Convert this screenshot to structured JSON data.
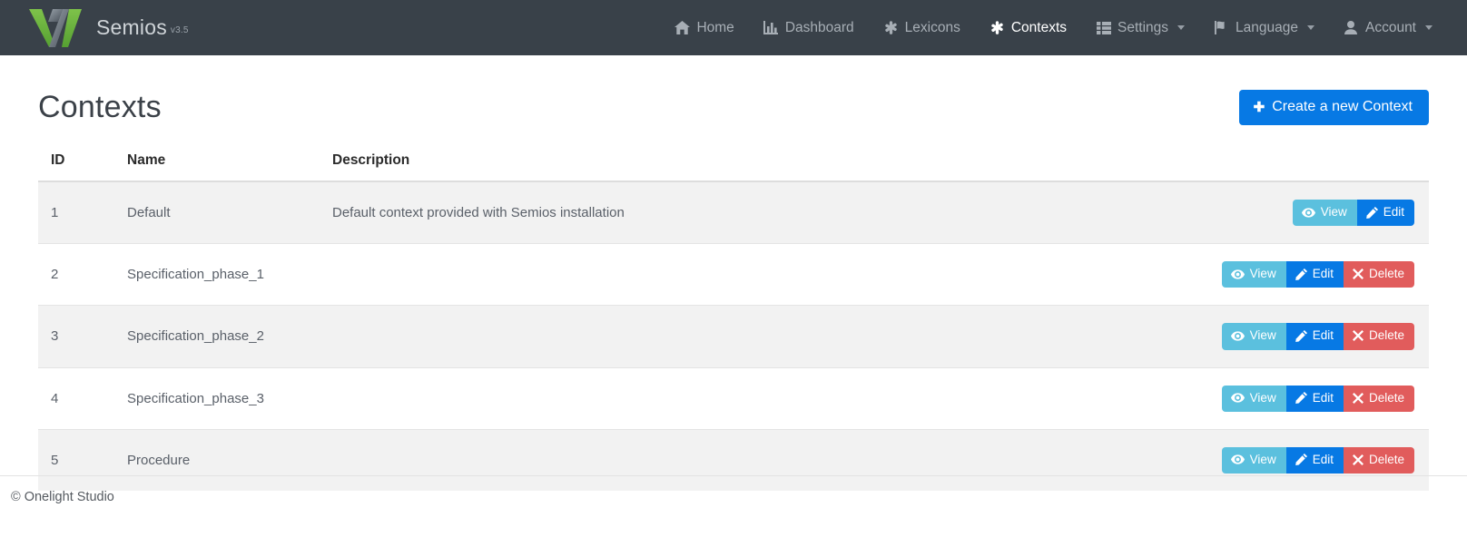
{
  "navbar": {
    "brand": {
      "name": "Semios",
      "version": "v3.5",
      "logo_icon": "semios-logo-icon"
    },
    "background_color": "#394149",
    "items": [
      {
        "label": "Home",
        "icon": "home-icon",
        "active": false,
        "caret": false
      },
      {
        "label": "Dashboard",
        "icon": "bar-chart-icon",
        "active": false,
        "caret": false
      },
      {
        "label": "Lexicons",
        "icon": "asterisk-icon",
        "active": false,
        "caret": false
      },
      {
        "label": "Contexts",
        "icon": "asterisk-icon",
        "active": true,
        "caret": false
      },
      {
        "label": "Settings",
        "icon": "th-list-icon",
        "active": false,
        "caret": true
      },
      {
        "label": "Language",
        "icon": "flag-icon",
        "active": false,
        "caret": true
      },
      {
        "label": "Account",
        "icon": "user-icon",
        "active": false,
        "caret": true
      }
    ]
  },
  "page": {
    "title": "Contexts",
    "create_button": {
      "label": "Create a new Context",
      "icon": "plus-icon",
      "color": "#0779e4"
    }
  },
  "table": {
    "columns": [
      "ID",
      "Name",
      "Description",
      ""
    ],
    "rows": [
      {
        "id": "1",
        "name": "Default",
        "description": "Default context provided with Semios installation",
        "actions": [
          {
            "label": "View",
            "icon": "eye-icon",
            "kind": "view"
          },
          {
            "label": "Edit",
            "icon": "pencil-icon",
            "kind": "edit"
          }
        ]
      },
      {
        "id": "2",
        "name": "Specification_phase_1",
        "description": "",
        "actions": [
          {
            "label": "View",
            "icon": "eye-icon",
            "kind": "view"
          },
          {
            "label": "Edit",
            "icon": "pencil-icon",
            "kind": "edit"
          },
          {
            "label": "Delete",
            "icon": "times-icon",
            "kind": "delete"
          }
        ]
      },
      {
        "id": "3",
        "name": "Specification_phase_2",
        "description": "",
        "actions": [
          {
            "label": "View",
            "icon": "eye-icon",
            "kind": "view"
          },
          {
            "label": "Edit",
            "icon": "pencil-icon",
            "kind": "edit"
          },
          {
            "label": "Delete",
            "icon": "times-icon",
            "kind": "delete"
          }
        ]
      },
      {
        "id": "4",
        "name": "Specification_phase_3",
        "description": "",
        "actions": [
          {
            "label": "View",
            "icon": "eye-icon",
            "kind": "view"
          },
          {
            "label": "Edit",
            "icon": "pencil-icon",
            "kind": "edit"
          },
          {
            "label": "Delete",
            "icon": "times-icon",
            "kind": "delete"
          }
        ]
      },
      {
        "id": "5",
        "name": "Procedure",
        "description": "",
        "actions": [
          {
            "label": "View",
            "icon": "eye-icon",
            "kind": "view"
          },
          {
            "label": "Edit",
            "icon": "pencil-icon",
            "kind": "edit"
          },
          {
            "label": "Delete",
            "icon": "times-icon",
            "kind": "delete"
          }
        ]
      }
    ]
  },
  "footer": {
    "copyright": "© Onelight Studio"
  }
}
